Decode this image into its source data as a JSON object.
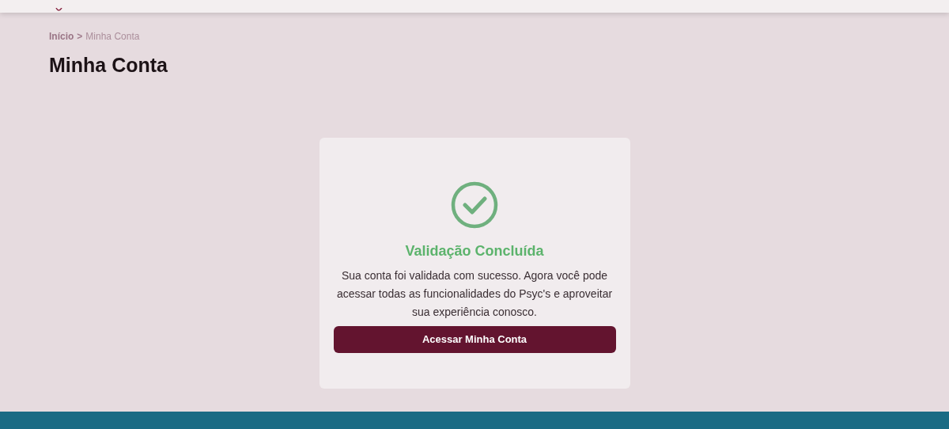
{
  "breadcrumb": {
    "items": [
      {
        "label": "Início",
        "selected": false
      },
      {
        "label": "Minha Conta",
        "selected": true
      }
    ],
    "separator": ">"
  },
  "page_title": "Minha Conta",
  "card": {
    "title": "Validação Concluída",
    "message": "Sua conta foi validada com sucesso. Agora você pode acessar todas as funcionalidades do Psyc's e aproveitar sua experiência conosco.",
    "button": "Acessar Minha Conta"
  }
}
